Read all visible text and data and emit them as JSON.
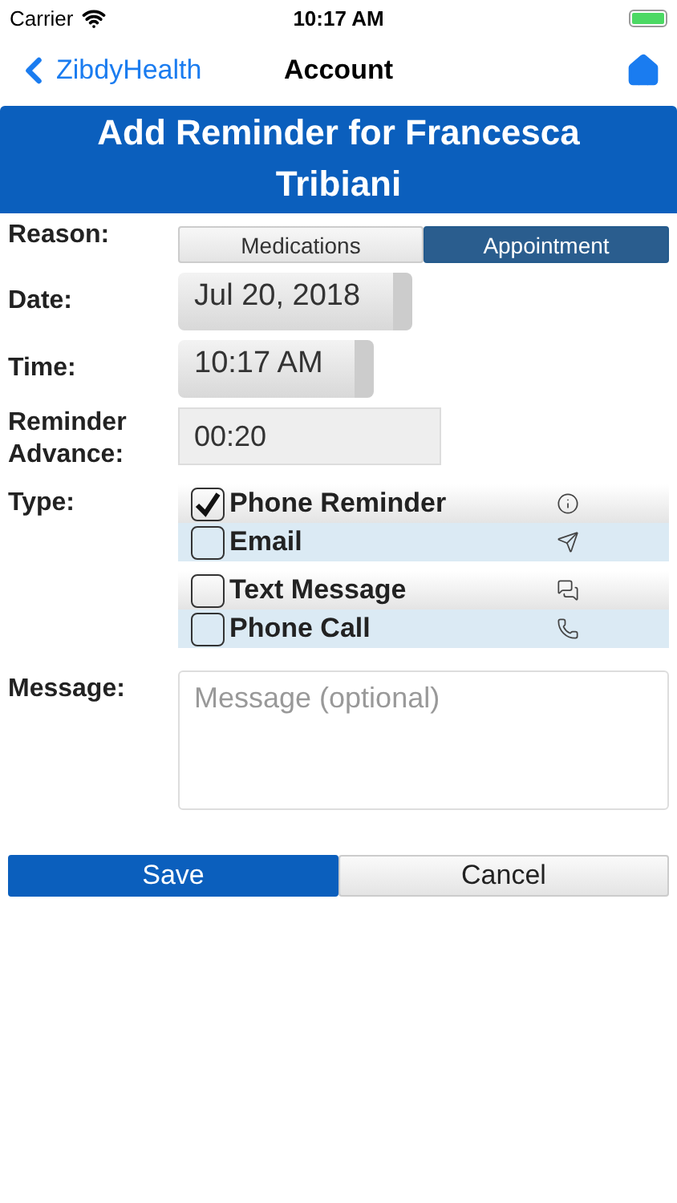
{
  "status_bar": {
    "carrier": "Carrier",
    "time": "10:17 AM"
  },
  "nav": {
    "back": "ZibdyHealth",
    "title": "Account"
  },
  "banner": {
    "title": "Add Reminder for Francesca Tribiani"
  },
  "reason": {
    "label": "Reason:",
    "options": [
      {
        "label": "Medications",
        "selected": false
      },
      {
        "label": "Appointment",
        "selected": true
      }
    ]
  },
  "date": {
    "label": "Date:",
    "value": "Jul 20, 2018"
  },
  "time": {
    "label": "Time:",
    "value": "10:17 AM"
  },
  "advance": {
    "label": "Reminder Advance:",
    "value": "00:20"
  },
  "type": {
    "label": "Type:",
    "options": [
      {
        "label": "Phone Reminder",
        "checked": true
      },
      {
        "label": "Email",
        "checked": false
      },
      {
        "label": "Text Message",
        "checked": false
      },
      {
        "label": "Phone Call",
        "checked": false
      }
    ]
  },
  "message": {
    "label": "Message:",
    "placeholder": "Message (optional)"
  },
  "buttons": [
    {
      "label": "Save",
      "kind": "primary"
    },
    {
      "label": "Cancel",
      "kind": "secondary"
    }
  ]
}
